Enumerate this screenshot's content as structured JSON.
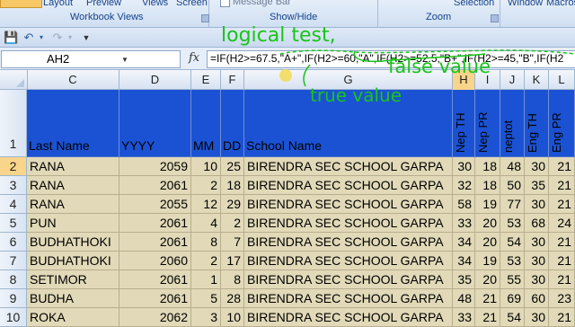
{
  "ribbon": {
    "buttons": [
      "Layout",
      "Preview",
      "Views",
      "Screen"
    ],
    "checkbox_label": "Message Bar",
    "selection": "Selection",
    "window": "Window",
    "macros": "Macros",
    "groups": [
      "Workbook Views",
      "Show/Hide",
      "Zoom"
    ]
  },
  "formula_bar": {
    "name_box": "AH2",
    "fx": "fx",
    "formula": "=IF(H2>=67.5,\"A+\",IF(H2>=60,\"A\",IF(H2>=52.5,\"B+\",IF(H2>=45,\"B\",IF(H2"
  },
  "annotations": {
    "logical_test": "logical test,",
    "false_value": "false value",
    "true_value": "true value"
  },
  "columns": [
    "C",
    "D",
    "E",
    "F",
    "G",
    "H",
    "I",
    "J",
    "K",
    "L"
  ],
  "headers": {
    "row_number": "1",
    "last_name": "Last Name",
    "yyyy": "YYYY",
    "mm": "MM",
    "dd": "DD",
    "school": "School Name",
    "nep_th": "Nep TH",
    "nep_pr": "Nep PR",
    "neptot": "neptot",
    "eng_th": "Eng TH",
    "eng_pr": "Eng PR"
  },
  "rows": [
    {
      "num": "2",
      "last": "RANA",
      "yyyy": "2059",
      "mm": "10",
      "dd": "25",
      "school": "BIRENDRA SEC SCHOOL GARPA",
      "h": "30",
      "i": "18",
      "j": "48",
      "k": "30",
      "l": "21"
    },
    {
      "num": "3",
      "last": "RANA",
      "yyyy": "2061",
      "mm": "2",
      "dd": "18",
      "school": "BIRENDRA SEC SCHOOL GARPA",
      "h": "32",
      "i": "18",
      "j": "50",
      "k": "35",
      "l": "21"
    },
    {
      "num": "4",
      "last": "RANA",
      "yyyy": "2055",
      "mm": "12",
      "dd": "29",
      "school": "BIRENDRA SEC SCHOOL GARPA",
      "h": "58",
      "i": "19",
      "j": "77",
      "k": "30",
      "l": "21"
    },
    {
      "num": "5",
      "last": "PUN",
      "yyyy": "2061",
      "mm": "4",
      "dd": "2",
      "school": "BIRENDRA SEC SCHOOL GARPA",
      "h": "33",
      "i": "20",
      "j": "53",
      "k": "68",
      "l": "24"
    },
    {
      "num": "6",
      "last": "BUDHATHOKI",
      "yyyy": "2061",
      "mm": "8",
      "dd": "7",
      "school": "BIRENDRA SEC SCHOOL GARPA",
      "h": "34",
      "i": "20",
      "j": "54",
      "k": "30",
      "l": "21"
    },
    {
      "num": "7",
      "last": "BUDHATHOKI",
      "yyyy": "2060",
      "mm": "2",
      "dd": "17",
      "school": "BIRENDRA SEC SCHOOL GARPA",
      "h": "34",
      "i": "19",
      "j": "53",
      "k": "30",
      "l": "21"
    },
    {
      "num": "8",
      "last": "SETIMOR",
      "yyyy": "2061",
      "mm": "1",
      "dd": "8",
      "school": "BIRENDRA SEC SCHOOL GARPA",
      "h": "35",
      "i": "20",
      "j": "55",
      "k": "30",
      "l": "21"
    },
    {
      "num": "9",
      "last": "BUDHA",
      "yyyy": "2061",
      "mm": "5",
      "dd": "28",
      "school": "BIRENDRA SEC SCHOOL GARPA",
      "h": "48",
      "i": "21",
      "j": "69",
      "k": "60",
      "l": "23"
    },
    {
      "num": "10",
      "last": "ROKA",
      "yyyy": "2062",
      "mm": "3",
      "dd": "10",
      "school": "BIRENDRA SEC SCHOOL GARPA",
      "h": "33",
      "i": "21",
      "j": "54",
      "k": "30",
      "l": "21"
    }
  ],
  "colors": {
    "header_fill": "#1b52d4",
    "data_fill": "#e1d9b8",
    "annotation": "#18c418",
    "active_row": "#f8d58a"
  }
}
